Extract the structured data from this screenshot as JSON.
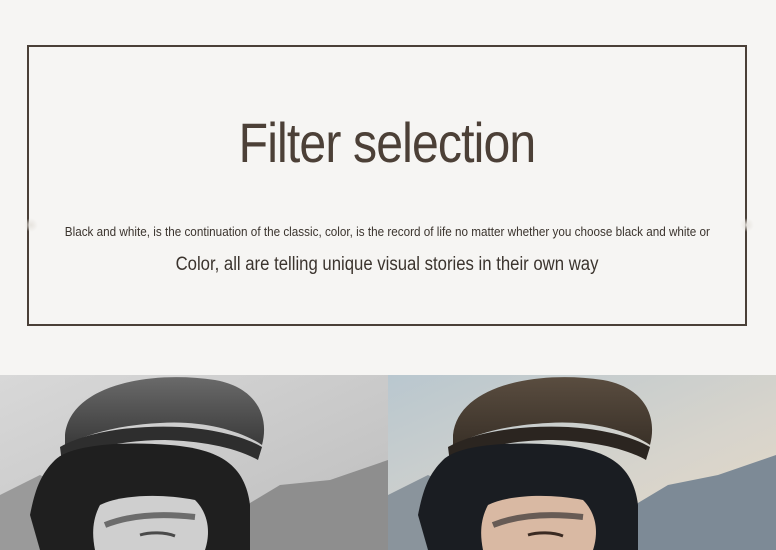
{
  "section": {
    "title": "Filter selection",
    "subtitle_line1": "Black and white, is the continuation of the classic, color, is the record of life no matter whether you choose black and white or",
    "subtitle_line2": "Color, all are telling unique visual stories in their own way"
  },
  "photos": [
    {
      "variant": "black-and-white"
    },
    {
      "variant": "color"
    }
  ],
  "colors": {
    "frame": "#4a4038",
    "title": "#4c4037",
    "text": "#3b342e",
    "background": "#f6f5f3"
  }
}
